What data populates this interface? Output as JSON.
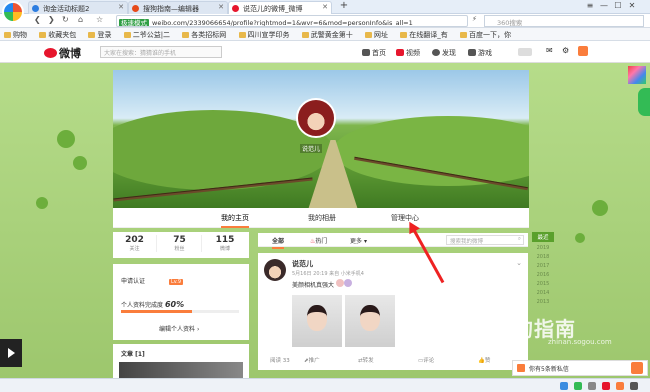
{
  "browser": {
    "tabs": [
      {
        "label": "询金活动标题2",
        "active": false,
        "icon_color": "#2d7de0"
      },
      {
        "label": "搜狗指南—编辑器",
        "active": false,
        "icon_color": "#e64a19"
      },
      {
        "label": "说范儿的微博_微博",
        "active": true,
        "icon_color": "#e6162d"
      }
    ],
    "new_tab": "+",
    "window_controls": [
      "≡",
      "—",
      "☐",
      "✕"
    ],
    "url_badge": "极速模式",
    "url": "weibo.com/2339066654/profile?rightmod=1&wvr=6&mod=personInfo&is_all=1",
    "search_placeholder": "360搜索",
    "bookmarks": [
      "购物",
      "收藏夹包",
      "登录",
      "二爷公益|二",
      "各类招标网",
      "四川宣学印务",
      "武警黄金第十",
      "网址",
      "在线翻译_有",
      "百度一下，你"
    ]
  },
  "weibo": {
    "logo": "微博",
    "search_placeholder": "大家在搜索：猜猜谁的手机",
    "nav": [
      {
        "label": "首页",
        "color": "#555"
      },
      {
        "label": "视频",
        "color": "#e6162d"
      },
      {
        "label": "发现",
        "color": "#555"
      },
      {
        "label": "游戏",
        "color": "#555"
      }
    ],
    "profile": {
      "name": "说范儿",
      "tabs": [
        "我的主页",
        "我的相册",
        "管理中心"
      ],
      "active_tab": "我的主页",
      "stats": [
        {
          "num": "202",
          "label": "关注"
        },
        {
          "num": "75",
          "label": "粉丝"
        },
        {
          "num": "115",
          "label": "微博"
        }
      ],
      "verify_label": "申请认证",
      "level": "Lv.9",
      "completion_label": "个人资料完成度",
      "completion": "60%",
      "completion_value": 0.6,
      "edit_link": "编辑个人资料",
      "album_label": "文章 [1]"
    },
    "feed": {
      "tabs": [
        "全部",
        "热门",
        "更多"
      ],
      "search_placeholder": "搜索我的微博",
      "post": {
        "name": "说范儿",
        "meta": "5月16日 20:19 来自 小米手机4",
        "text": "美颜相机真强大",
        "actions": [
          "阅读 33",
          "推广",
          "转发",
          "评论",
          "赞"
        ]
      }
    },
    "timeline": {
      "head": "最近",
      "years": [
        "2019",
        "2018",
        "2017",
        "2016",
        "2015",
        "2014",
        "2013"
      ]
    }
  },
  "watermark": {
    "main": "搜狗指南",
    "sub": "zhinan.sogou.com"
  },
  "chat_popup": "你有5条新私信",
  "colors": {
    "accent": "#fa7d3c",
    "weibo_red": "#e6162d",
    "page_green": "#a8d07a",
    "arrow": "#e22222"
  }
}
